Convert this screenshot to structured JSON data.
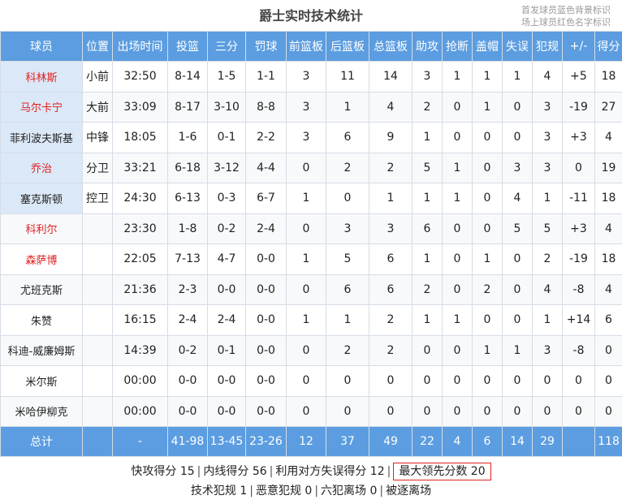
{
  "title": "爵士实时技术统计",
  "notes": [
    "首发球员蓝色背景标识",
    "场上球员红色名字标识"
  ],
  "headers": [
    "球员",
    "位置",
    "出场时间",
    "投篮",
    "三分",
    "罚球",
    "前篮板",
    "后篮板",
    "总篮板",
    "助攻",
    "抢断",
    "盖帽",
    "失误",
    "犯规",
    "+/-",
    "得分"
  ],
  "players": [
    {
      "name": "科林斯",
      "pos": "小前",
      "starter": true,
      "on_court": true,
      "stats": [
        "32:50",
        "8-14",
        "1-5",
        "1-1",
        "3",
        "11",
        "14",
        "3",
        "1",
        "1",
        "1",
        "4",
        "+5",
        "18"
      ]
    },
    {
      "name": "马尔卡宁",
      "pos": "大前",
      "starter": true,
      "on_court": true,
      "stats": [
        "33:09",
        "8-17",
        "3-10",
        "8-8",
        "3",
        "1",
        "4",
        "2",
        "0",
        "1",
        "0",
        "3",
        "-19",
        "27"
      ]
    },
    {
      "name": "菲利波夫斯基",
      "pos": "中锋",
      "starter": true,
      "on_court": false,
      "stats": [
        "18:05",
        "1-6",
        "0-1",
        "2-2",
        "3",
        "6",
        "9",
        "1",
        "0",
        "0",
        "0",
        "3",
        "+3",
        "4"
      ]
    },
    {
      "name": "乔治",
      "pos": "分卫",
      "starter": true,
      "on_court": true,
      "stats": [
        "33:21",
        "6-18",
        "3-12",
        "4-4",
        "0",
        "2",
        "2",
        "5",
        "1",
        "0",
        "3",
        "3",
        "0",
        "19"
      ]
    },
    {
      "name": "塞克斯顿",
      "pos": "控卫",
      "starter": true,
      "on_court": false,
      "stats": [
        "24:30",
        "6-13",
        "0-3",
        "6-7",
        "1",
        "0",
        "1",
        "1",
        "1",
        "0",
        "4",
        "1",
        "-11",
        "18"
      ]
    },
    {
      "name": "科利尔",
      "pos": "",
      "starter": false,
      "on_court": true,
      "stats": [
        "23:30",
        "1-8",
        "0-2",
        "2-4",
        "0",
        "3",
        "3",
        "6",
        "0",
        "0",
        "5",
        "5",
        "+3",
        "4"
      ]
    },
    {
      "name": "森萨博",
      "pos": "",
      "starter": false,
      "on_court": true,
      "stats": [
        "22:05",
        "7-13",
        "4-7",
        "0-0",
        "1",
        "5",
        "6",
        "1",
        "0",
        "1",
        "0",
        "2",
        "-19",
        "18"
      ]
    },
    {
      "name": "尤班克斯",
      "pos": "",
      "starter": false,
      "on_court": false,
      "stats": [
        "21:36",
        "2-3",
        "0-0",
        "0-0",
        "0",
        "6",
        "6",
        "2",
        "0",
        "2",
        "0",
        "4",
        "-8",
        "4"
      ]
    },
    {
      "name": "朱赞",
      "pos": "",
      "starter": false,
      "on_court": false,
      "stats": [
        "16:15",
        "2-4",
        "2-4",
        "0-0",
        "1",
        "1",
        "2",
        "1",
        "1",
        "0",
        "0",
        "1",
        "+14",
        "6"
      ]
    },
    {
      "name": "科迪-威廉姆斯",
      "pos": "",
      "starter": false,
      "on_court": false,
      "stats": [
        "14:39",
        "0-2",
        "0-1",
        "0-0",
        "0",
        "2",
        "2",
        "0",
        "0",
        "1",
        "1",
        "3",
        "-8",
        "0"
      ]
    },
    {
      "name": "米尔斯",
      "pos": "",
      "starter": false,
      "on_court": false,
      "stats": [
        "00:00",
        "0-0",
        "0-0",
        "0-0",
        "0",
        "0",
        "0",
        "0",
        "0",
        "0",
        "0",
        "0",
        "0",
        "0"
      ]
    },
    {
      "name": "米哈伊柳克",
      "pos": "",
      "starter": false,
      "on_court": false,
      "stats": [
        "00:00",
        "0-0",
        "0-0",
        "0-0",
        "0",
        "0",
        "0",
        "0",
        "0",
        "0",
        "0",
        "0",
        "0",
        "0"
      ]
    }
  ],
  "totals": {
    "label": "总计",
    "pos": "",
    "stats": [
      "-",
      "41-98",
      "13-45",
      "23-26",
      "12",
      "37",
      "49",
      "22",
      "4",
      "6",
      "14",
      "29",
      "",
      "118"
    ]
  },
  "summary": {
    "line1": [
      "快攻得分 15",
      "内线得分 56",
      "利用对方失误得分 12"
    ],
    "highlight": "最大领先分数 20",
    "line2": [
      "技术犯规 1",
      "恶意犯规 0",
      "六犯离场 0",
      "被逐离场"
    ]
  },
  "colors": {
    "header_bg": "#5b9de0",
    "starter_bg": "#dbe8f7",
    "on_court_name": "#e02020",
    "highlight_border": "#e02020"
  }
}
